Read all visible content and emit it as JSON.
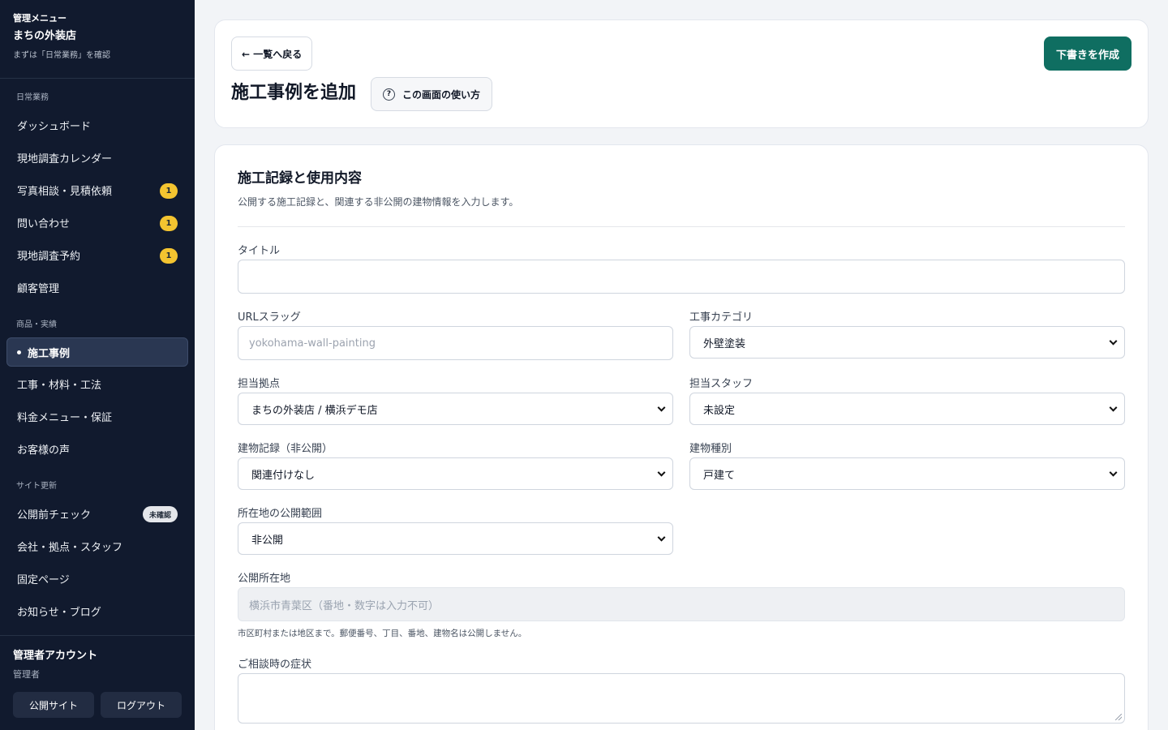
{
  "sidebar": {
    "caption": "管理メニュー",
    "shop_name": "まちの外装店",
    "hint": "まずは「日常業務」を確認",
    "sections": [
      "日常業務",
      "商品・実績",
      "サイト更新"
    ],
    "items": [
      {
        "label": "ダッシュボード"
      },
      {
        "label": "現地調査カレンダー"
      },
      {
        "label": "写真相談・見積依頼",
        "badge": "1"
      },
      {
        "label": "問い合わせ",
        "badge": "1"
      },
      {
        "label": "現地調査予約",
        "badge": "1"
      },
      {
        "label": "顧客管理"
      },
      {
        "label": "施工事例"
      },
      {
        "label": "工事・材料・工法"
      },
      {
        "label": "料金メニュー・保証"
      },
      {
        "label": "お客様の声"
      },
      {
        "label": "公開前チェック",
        "badge": "未確認"
      },
      {
        "label": "会社・拠点・スタッフ"
      },
      {
        "label": "固定ページ"
      },
      {
        "label": "お知らせ・ブログ"
      }
    ],
    "account": "管理者アカウント",
    "role": "管理者",
    "public_site": "公開サイト",
    "logout": "ログアウト"
  },
  "header": {
    "back": "← 一覧へ戻る",
    "title": "施工事例を追加",
    "help": "この画面の使い方",
    "help_icon": "?",
    "draft": "下書きを作成"
  },
  "form": {
    "title": "施工記録と使用内容",
    "desc": "公開する施工記録と、関連する非公開の建物情報を入力します。",
    "fields": {
      "title": {
        "label": "タイトル",
        "value": ""
      },
      "slug": {
        "label": "URLスラッグ",
        "placeholder": "yokohama-wall-painting"
      },
      "category": {
        "label": "工事カテゴリ",
        "value": "外壁塗装"
      },
      "base": {
        "label": "担当拠点",
        "value": "まちの外装店 / 横浜デモ店"
      },
      "staff": {
        "label": "担当スタッフ",
        "value": "未設定"
      },
      "building": {
        "label": "建物記録（非公開）",
        "value": "関連付けなし"
      },
      "building_type": {
        "label": "建物種別",
        "value": "戸建て"
      },
      "scope": {
        "label": "所在地の公開範囲",
        "value": "非公開"
      },
      "address": {
        "label": "公開所在地",
        "placeholder": "横浜市青葉区（番地・数字は入力不可）",
        "note": "市区町村または地区まで。郵便番号、丁目、番地、建物名は公開しません。"
      },
      "symptom": {
        "label": "ご相談時の症状",
        "value": ""
      }
    }
  }
}
